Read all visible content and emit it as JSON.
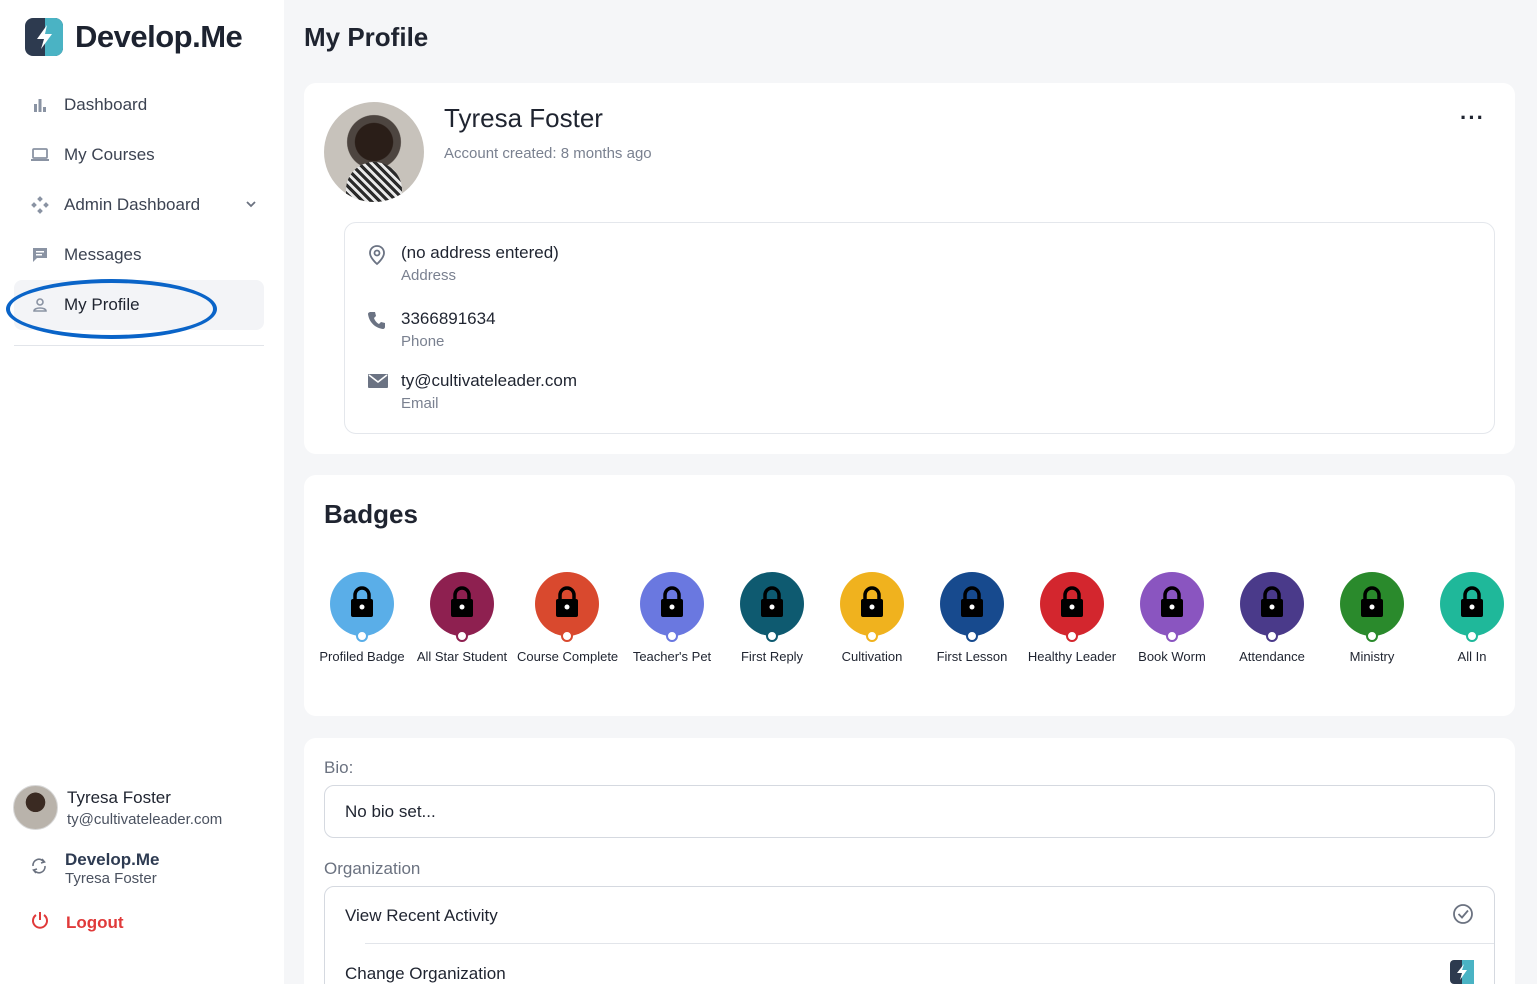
{
  "app": {
    "name": "Develop.Me"
  },
  "sidebar": {
    "items": [
      {
        "label": "Dashboard",
        "icon": "bar-chart-icon"
      },
      {
        "label": "My Courses",
        "icon": "laptop-icon"
      },
      {
        "label": "Admin Dashboard",
        "icon": "admin-icon"
      },
      {
        "label": "Messages",
        "icon": "chat-icon"
      },
      {
        "label": "My Profile",
        "icon": "user-icon"
      }
    ],
    "active": "My Profile",
    "user": {
      "name": "Tyresa Foster",
      "email": "ty@cultivateleader.com"
    },
    "org": {
      "name": "Develop.Me",
      "user": "Tyresa Foster"
    },
    "logout_label": "Logout"
  },
  "page": {
    "title": "My Profile"
  },
  "profile": {
    "name": "Tyresa Foster",
    "created": "Account created: 8 months ago",
    "address": {
      "value": "(no address entered)",
      "label": "Address"
    },
    "phone": {
      "value": "3366891634",
      "label": "Phone"
    },
    "email": {
      "value": "ty@cultivateleader.com",
      "label": "Email"
    }
  },
  "badges": {
    "title": "Badges",
    "items": [
      {
        "label": "Profiled Badge",
        "color": "#5aaee8"
      },
      {
        "label": "All Star Student",
        "color": "#8e2050"
      },
      {
        "label": "Course Complete",
        "color": "#d9492e"
      },
      {
        "label": "Teacher's Pet",
        "color": "#6a78e0"
      },
      {
        "label": "First Reply",
        "color": "#0e5a70"
      },
      {
        "label": "Cultivation",
        "color": "#f0b21e"
      },
      {
        "label": "First Lesson",
        "color": "#174a8e"
      },
      {
        "label": "Healthy Leader",
        "color": "#d3262e"
      },
      {
        "label": "Book Worm",
        "color": "#8a55c0"
      },
      {
        "label": "Attendance",
        "color": "#4a3a8a"
      },
      {
        "label": "Ministry",
        "color": "#2a8a2c"
      },
      {
        "label": "All In",
        "color": "#1fb89a"
      }
    ]
  },
  "bio": {
    "label": "Bio:",
    "value": "No bio set..."
  },
  "organization": {
    "label": "Organization",
    "items": [
      "View Recent Activity",
      "Change Organization"
    ]
  }
}
